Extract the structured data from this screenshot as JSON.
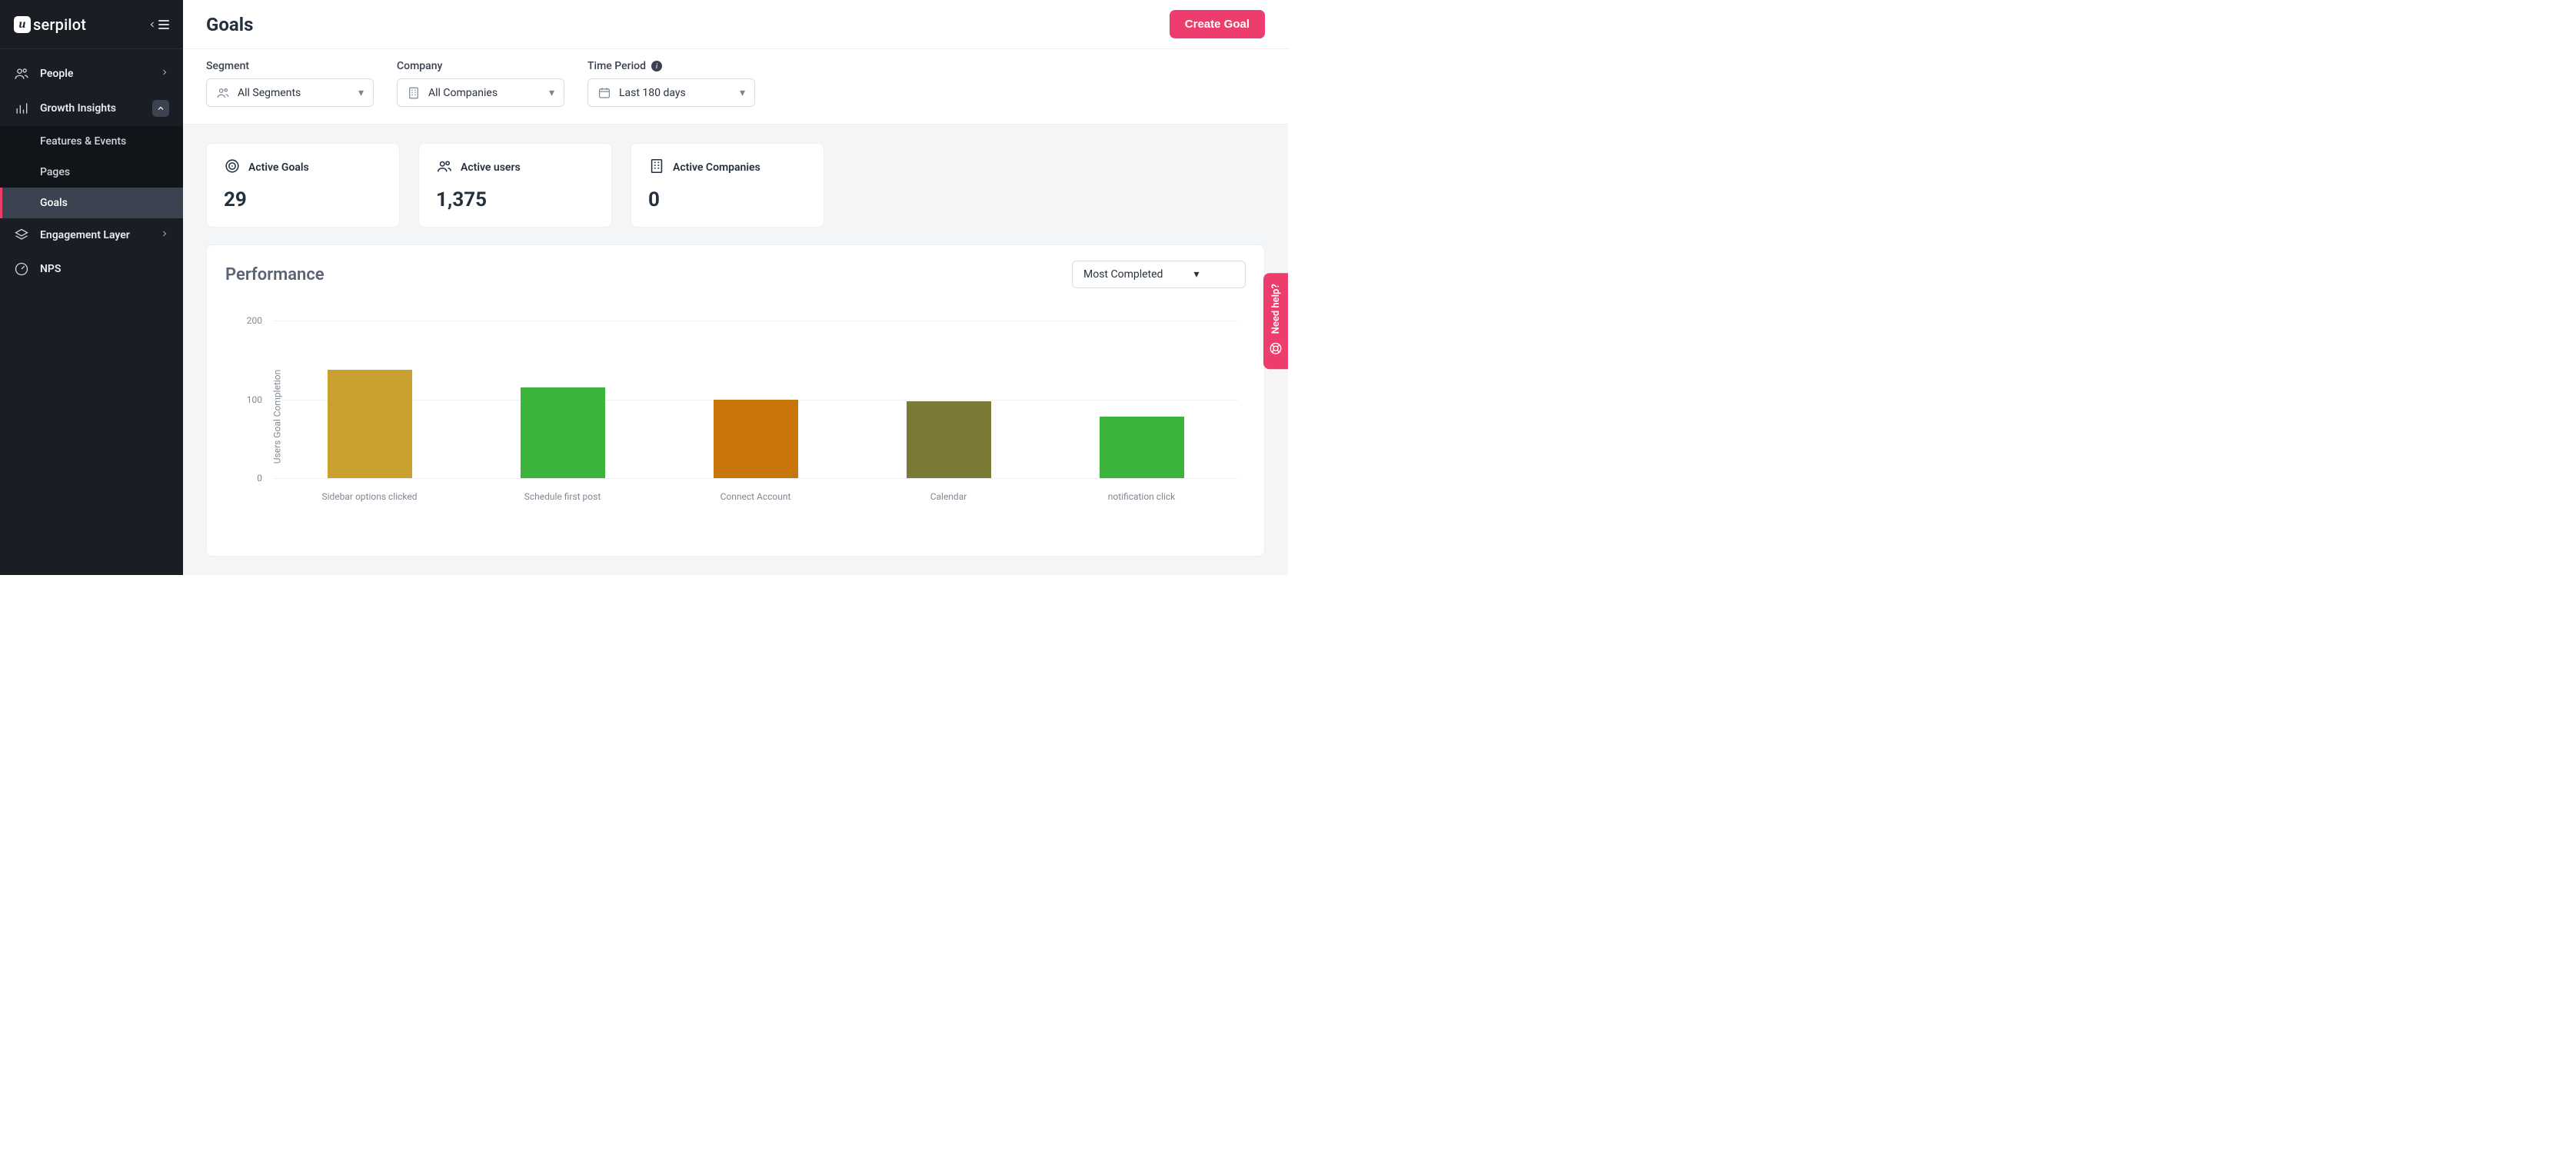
{
  "brand": {
    "name": "serpilot",
    "mark_letter": "u"
  },
  "sidebar": {
    "items": [
      {
        "label": "People"
      },
      {
        "label": "Growth Insights",
        "children": [
          {
            "label": "Features & Events"
          },
          {
            "label": "Pages"
          },
          {
            "label": "Goals",
            "active": true
          }
        ]
      },
      {
        "label": "Engagement Layer"
      },
      {
        "label": "NPS"
      }
    ]
  },
  "header": {
    "title": "Goals",
    "create_button": "Create Goal"
  },
  "filters": {
    "segment_label": "Segment",
    "segment_value": "All Segments",
    "company_label": "Company",
    "company_value": "All Companies",
    "time_label": "Time Period",
    "time_value": "Last 180 days"
  },
  "stats": [
    {
      "label": "Active Goals",
      "value": "29",
      "icon": "target"
    },
    {
      "label": "Active users",
      "value": "1,375",
      "icon": "users"
    },
    {
      "label": "Active Companies",
      "value": "0",
      "icon": "company"
    }
  ],
  "performance": {
    "title": "Performance",
    "sort_value": "Most Completed",
    "ylabel": "Users Goal Completion"
  },
  "chart_data": {
    "type": "bar",
    "ylabel": "Users Goal Completion",
    "ylim": [
      0,
      220
    ],
    "yticks": [
      0,
      100,
      200
    ],
    "categories": [
      "Sidebar options clicked",
      "Schedule first post",
      "Connect Account",
      "Calendar",
      "notification click"
    ],
    "values": [
      138,
      115,
      100,
      98,
      78
    ],
    "colors": [
      "#c99f2f",
      "#3cb43c",
      "#c8760b",
      "#7b7a34",
      "#3cb43c"
    ]
  },
  "help_tab": {
    "label": "Need help?"
  }
}
